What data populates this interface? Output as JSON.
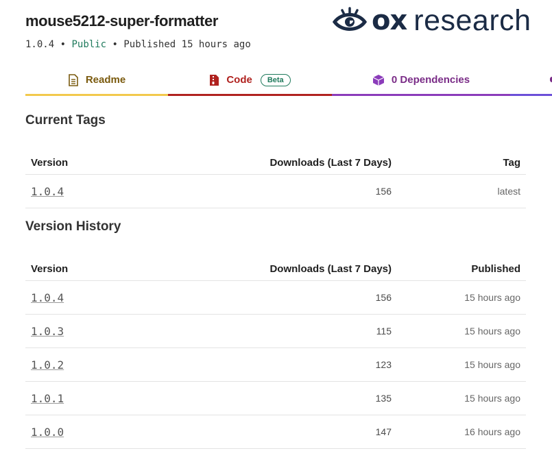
{
  "package": {
    "name": "mouse5212-super-formatter",
    "version": "1.0.4",
    "visibility": "Public",
    "published": "Published 15 hours ago",
    "separator": "•"
  },
  "brand": {
    "ox": "ox",
    "research": "research",
    "icon": "eye-logo-icon"
  },
  "tabs": [
    {
      "label": "Readme",
      "icon": "document-icon",
      "color": "#7a5a0e",
      "underline": "#f2c94c"
    },
    {
      "label": "Code",
      "icon": "file-zip-icon",
      "badge": "Beta",
      "color": "#b0221f",
      "underline": "#b0221f"
    },
    {
      "label": "0 Dependencies",
      "icon": "box-icon",
      "color": "#7a2c87",
      "underline": "#8b3cba"
    }
  ],
  "current_tags": {
    "title": "Current Tags",
    "headers": {
      "version": "Version",
      "downloads": "Downloads (Last 7 Days)",
      "tag": "Tag"
    },
    "rows": [
      {
        "version": "1.0.4",
        "downloads": "156",
        "tag": "latest"
      }
    ]
  },
  "version_history": {
    "title": "Version History",
    "headers": {
      "version": "Version",
      "downloads": "Downloads (Last 7 Days)",
      "published": "Published"
    },
    "rows": [
      {
        "version": "1.0.4",
        "downloads": "156",
        "published": "15 hours ago"
      },
      {
        "version": "1.0.3",
        "downloads": "115",
        "published": "15 hours ago"
      },
      {
        "version": "1.0.2",
        "downloads": "123",
        "published": "15 hours ago"
      },
      {
        "version": "1.0.1",
        "downloads": "135",
        "published": "15 hours ago"
      },
      {
        "version": "1.0.0",
        "downloads": "147",
        "published": "16 hours ago"
      }
    ]
  }
}
